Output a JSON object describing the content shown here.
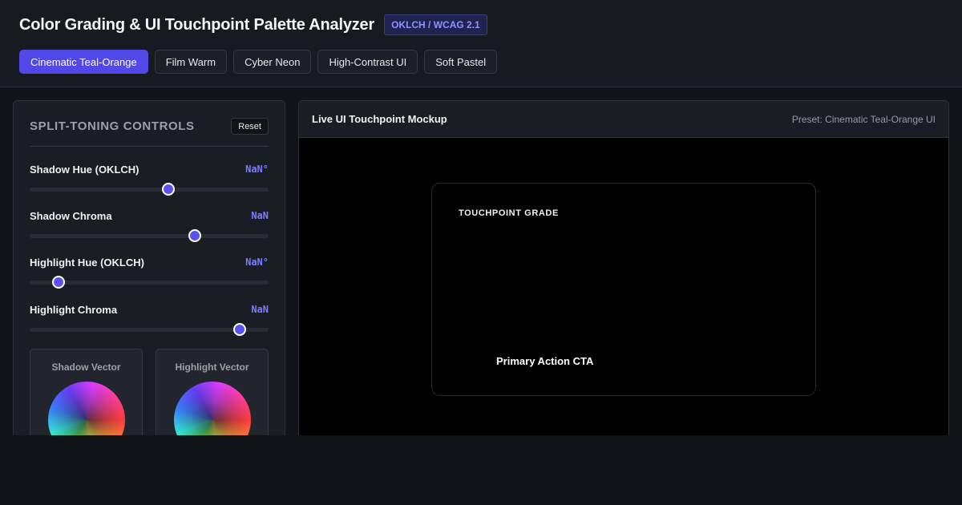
{
  "header": {
    "title": "Color Grading & UI Touchpoint Palette Analyzer",
    "badge": "OKLCH / WCAG 2.1",
    "presets": [
      {
        "label": "Cinematic Teal-Orange",
        "active": true
      },
      {
        "label": "Film Warm",
        "active": false
      },
      {
        "label": "Cyber Neon",
        "active": false
      },
      {
        "label": "High-Contrast UI",
        "active": false
      },
      {
        "label": "Soft Pastel",
        "active": false
      }
    ]
  },
  "controls": {
    "title": "SPLIT-TONING CONTROLS",
    "reset_label": "Reset",
    "sliders": [
      {
        "label": "Shadow Hue (OKLCH)",
        "value_text": "NaN°",
        "fraction": 0.58
      },
      {
        "label": "Shadow Chroma",
        "value_text": "NaN",
        "fraction": 0.69
      },
      {
        "label": "Highlight Hue (OKLCH)",
        "value_text": "NaN°",
        "fraction": 0.12
      },
      {
        "label": "Highlight Chroma",
        "value_text": "NaN",
        "fraction": 0.88
      }
    ],
    "shadow_vector_label": "Shadow Vector",
    "highlight_vector_label": "Highlight Vector"
  },
  "mockup": {
    "title": "Live UI Touchpoint Mockup",
    "preset_text": "Preset: Cinematic Teal-Orange UI",
    "grade_label": "TOUCHPOINT GRADE",
    "cta_label": "Primary Action CTA"
  },
  "colors": {
    "accent": "#5049e8",
    "value_text": "#7a7dff",
    "page_bg": "#121319"
  }
}
